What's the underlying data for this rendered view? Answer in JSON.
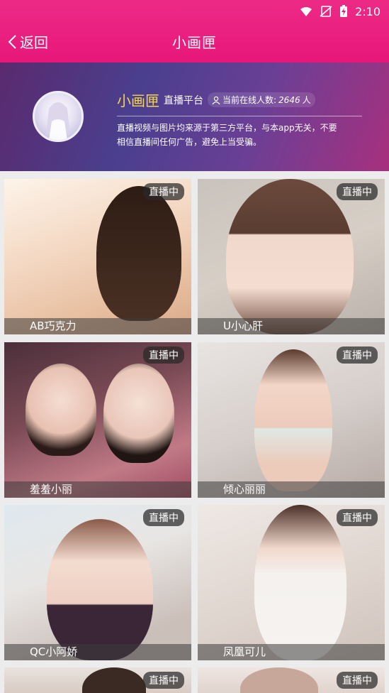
{
  "status_bar": {
    "time": "2:10"
  },
  "nav": {
    "back_label": "返回",
    "title": "小画匣"
  },
  "banner": {
    "brand": "小画匣",
    "subtitle": "直播平台",
    "online_label": "当前在线人数:",
    "online_count": "2646",
    "online_unit": "人",
    "notice_line1": "直播视频与图片均来源于第三方平台，与本app无关，不要",
    "notice_line2": "相信直播间任何广告，避免上当受骗。"
  },
  "streams": [
    {
      "name": "AB巧克力",
      "badge": "直播中"
    },
    {
      "name": "U小心肝",
      "badge": "直播中"
    },
    {
      "name": "羞羞小丽",
      "badge": "直播中"
    },
    {
      "name": "倾心丽丽",
      "badge": "直播中"
    },
    {
      "name": "QC小阿娇",
      "badge": "直播中"
    },
    {
      "name": "凤凰可儿",
      "badge": "直播中"
    },
    {
      "name": "",
      "badge": "直播中"
    },
    {
      "name": "",
      "badge": "直播中"
    }
  ],
  "colors": {
    "header": "#e8177a",
    "brand_gold": "#f7d54a"
  }
}
